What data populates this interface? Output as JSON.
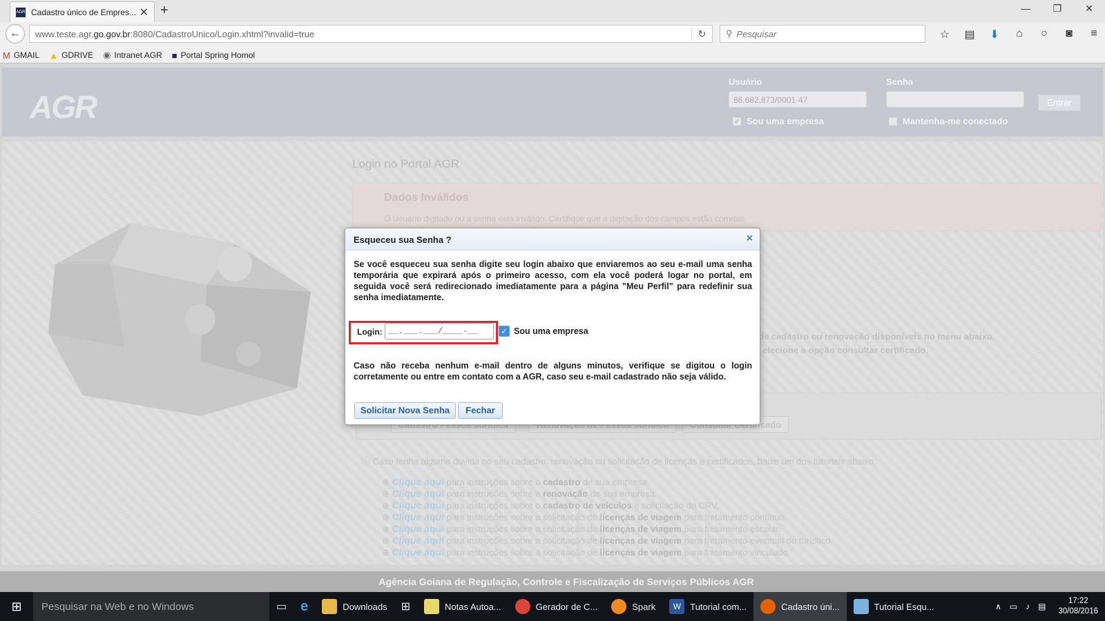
{
  "browser": {
    "tab_title": "Cadastro único de Empres...",
    "tab_favicon": "AGR",
    "url_prefix": "www.teste.agr.",
    "url_domain": "go.gov.br",
    "url_rest": ":8080/CadastroUnico/Login.xhtml?invalid=true",
    "search_placeholder": "Pesquisar",
    "bookmarks": [
      "GMAIL",
      "GDRIVE",
      "Intranet AGR",
      "Portal Spring Homol"
    ]
  },
  "header": {
    "logo": "AGR",
    "usuario_label": "Usuário",
    "usuario_value": "86.682.873/0001-47",
    "senha_label": "Senha",
    "entrar_label": "Entrar",
    "sou_empresa_label": "Sou uma empresa",
    "mantenha_label": "Mantenha-me conectado"
  },
  "page": {
    "title": "Login no Portal AGR",
    "error_title": "Dados Inválidos",
    "error_message": "O Usuário digitado ou a senha está inválido. Certifique que a digitação dos campos estão corretas",
    "bg_text_1": "de cadastro ou renovação disponíveis no menu abaixo.",
    "bg_text_2": "elecione a opção consultar certificado.",
    "tabs": [
      "Cadastro Pessoa Jurídica",
      "Renovação de Pessoa Jurídica",
      "Consultar Certificado"
    ],
    "info_text": "Caso tenha alguma dúvida no seu cadastro, renovação ou solicitação de licenças e certificados, baixe um dos tutoriais abaixo:",
    "tutorials": [
      {
        "link": "Clique aqui",
        "pre": "para instruções sobre o",
        "bold": "cadastro",
        "post": "de sua empresa."
      },
      {
        "link": "Clique aqui",
        "pre": "para instruções sobre a",
        "bold": "renovação",
        "post": "de sua empresa."
      },
      {
        "link": "Clique aqui",
        "pre": "para instruções sobre o",
        "bold": "cadastro de veículos",
        "post": "e solicitação do CRV."
      },
      {
        "link": "Clique aqui",
        "pre": "para instruções sobre a solicitação de",
        "bold": "licenças de viagem",
        "post": "para fretamento contínuo."
      },
      {
        "link": "Clique aqui",
        "pre": "para instruções sobre a solicitação de",
        "bold": "licenças de viagem",
        "post": "para fretamento escolar."
      },
      {
        "link": "Clique aqui",
        "pre": "para instruções sobre a solicitação de",
        "bold": "licenças de viagem",
        "post": "para fretamento eventual ou turístico."
      },
      {
        "link": "Clique aqui",
        "pre": "para instruções sobre a solicitação de",
        "bold": "licenças de viagem",
        "post": "para fretamento vinculado."
      }
    ],
    "footer": "Agência Goiana de Regulação, Controle e Fiscalização de Serviços Públicos   AGR"
  },
  "dialog": {
    "title": "Esqueceu sua Senha ?",
    "intro": "Se você esqueceu sua senha digite seu login abaixo que enviaremos ao seu e-mail uma senha temporária que expirará após o primeiro acesso, com ela você poderá logar no portal, em seguida você será redirecionado imediatamente para a página \"Meu Perfil\" para redefinir sua senha imediatamente.",
    "login_label": "Login:",
    "login_mask": "__.___.___/____-__",
    "sou_empresa_label": "Sou uma empresa",
    "note": "Caso não receba nenhum e-mail dentro de alguns minutos, verifique se digitou o login corretamente ou entre em contato com a AGR, caso seu e-mail cadastrado não seja válido.",
    "submit_label": "Solicitar Nova Senha",
    "close_label": "Fechar"
  },
  "taskbar": {
    "search_placeholder": "Pesquisar na Web e no Windows",
    "apps": [
      "Downloads",
      "Notas Autoa...",
      "Gerador de C...",
      "Spark",
      "Tutorial com...",
      "Cadastro úni...",
      "Tutorial Esqu..."
    ],
    "time": "17:22",
    "date": "30/08/2016"
  }
}
